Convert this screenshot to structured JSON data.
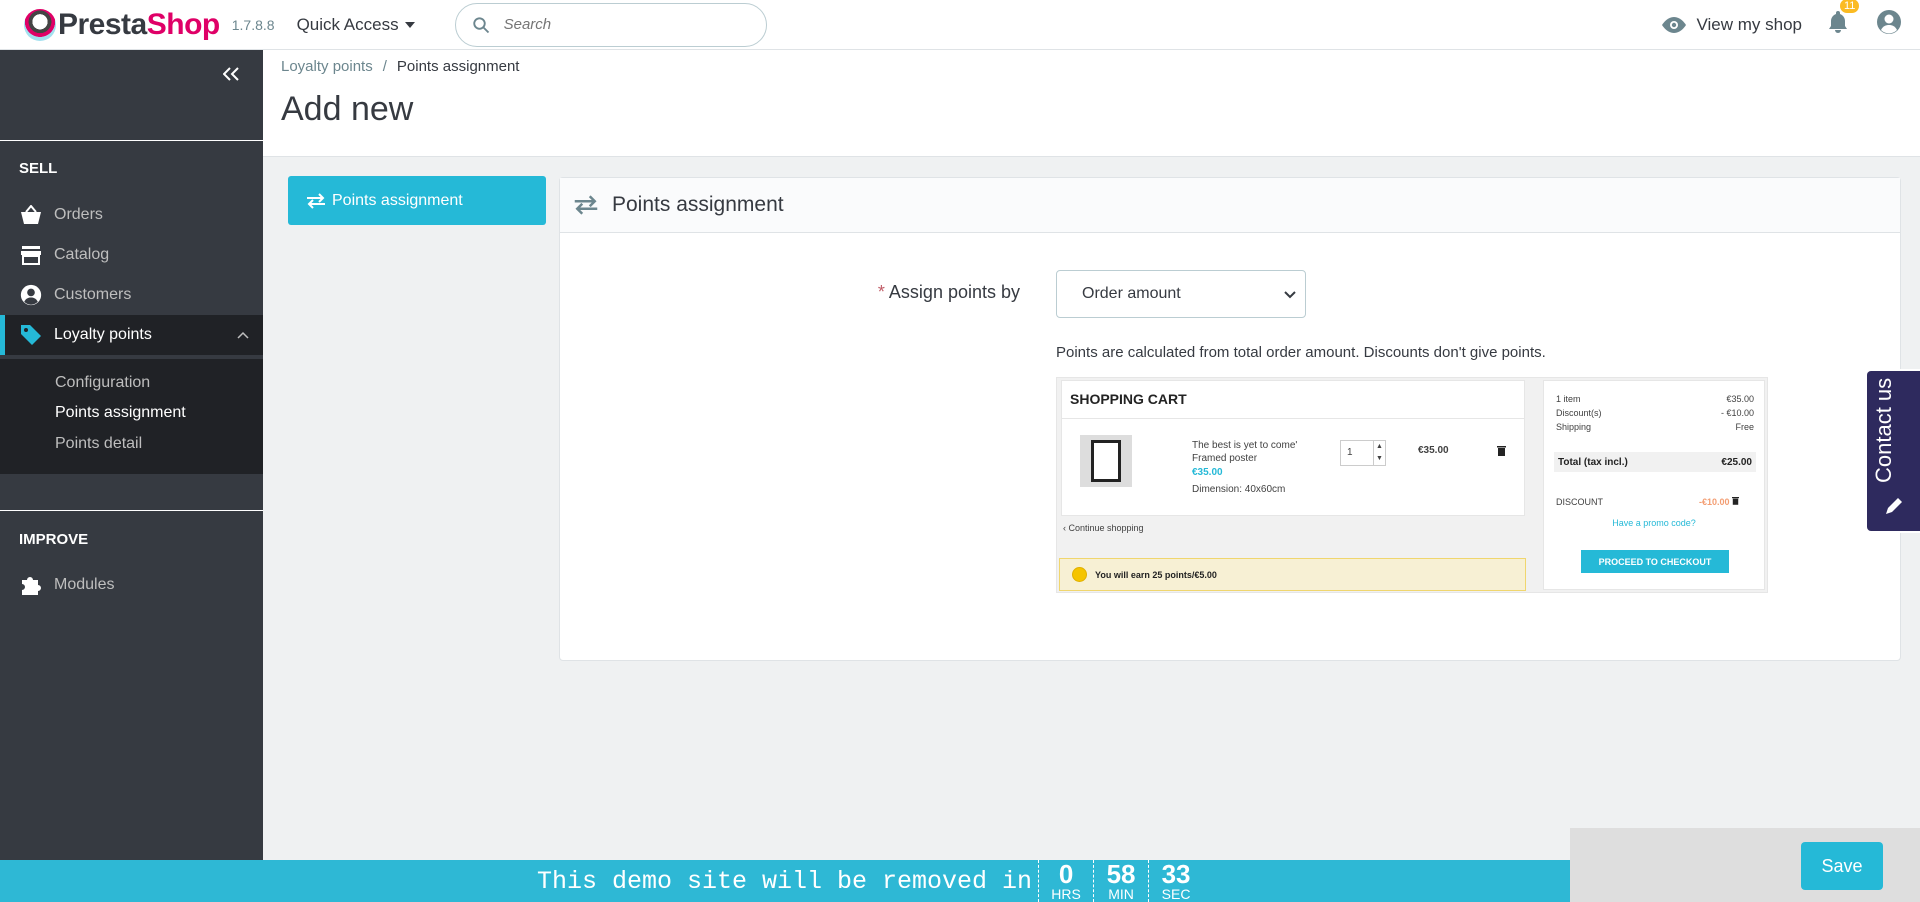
{
  "header": {
    "logo_text_main": "Presta",
    "logo_text_accent": "Shop",
    "version": "1.7.8.8",
    "quick_access": "Quick Access",
    "search_placeholder": "Search",
    "view_shop": "View my shop",
    "notification_count": "11"
  },
  "sidebar": {
    "sell_title": "SELL",
    "improve_title": "IMPROVE",
    "items": [
      {
        "label": "Orders",
        "icon": "basket-icon"
      },
      {
        "label": "Catalog",
        "icon": "store-icon"
      },
      {
        "label": "Customers",
        "icon": "account-circle-icon"
      },
      {
        "label": "Loyalty points",
        "icon": "tag-icon"
      }
    ],
    "submenu": [
      "Configuration",
      "Points assignment",
      "Points detail"
    ],
    "modules": "Modules"
  },
  "breadcrumb": {
    "parent": "Loyalty points",
    "separator": "/",
    "current": "Points assignment"
  },
  "page_title": "Add new",
  "left_tab": "Points assignment",
  "panel": {
    "title": "Points assignment",
    "required_mark": "*",
    "field_label": "Assign points by",
    "select_value": "Order amount",
    "help_text": "Points are calculated from total order amount. Discounts don't give points."
  },
  "preview": {
    "cart_title": "SHOPPING CART",
    "product_name_1": "The best is yet to come'",
    "product_name_2": "Framed poster",
    "product_price": "€35.00",
    "product_dimension": "Dimension: 40x60cm",
    "qty": "1",
    "line_price": "€35.00",
    "continue": "Continue shopping",
    "earn_text": "You will earn 25 points/€5.00",
    "summary": {
      "items_label": "1 item",
      "items_value": "€35.00",
      "discount_label": "Discount(s)",
      "discount_value": "- €10.00",
      "shipping_label": "Shipping",
      "shipping_value": "Free",
      "total_label": "Total (tax incl.)",
      "total_value": "€25.00",
      "discount_code_label": "DISCOUNT",
      "discount_code_value": "-€10.00",
      "promo": "Have a promo code?",
      "checkout": "PROCEED TO CHECKOUT"
    }
  },
  "contact": "Contact us",
  "demo": {
    "text": "This demo site will be removed in",
    "hrs": "0",
    "hrs_label": "HRS",
    "min": "58",
    "min_label": "MIN",
    "sec": "33",
    "sec_label": "SEC"
  },
  "save_label": "Save",
  "colors": {
    "accent": "#25b9d7",
    "sidebar": "#363a41",
    "brand": "#df0067"
  }
}
